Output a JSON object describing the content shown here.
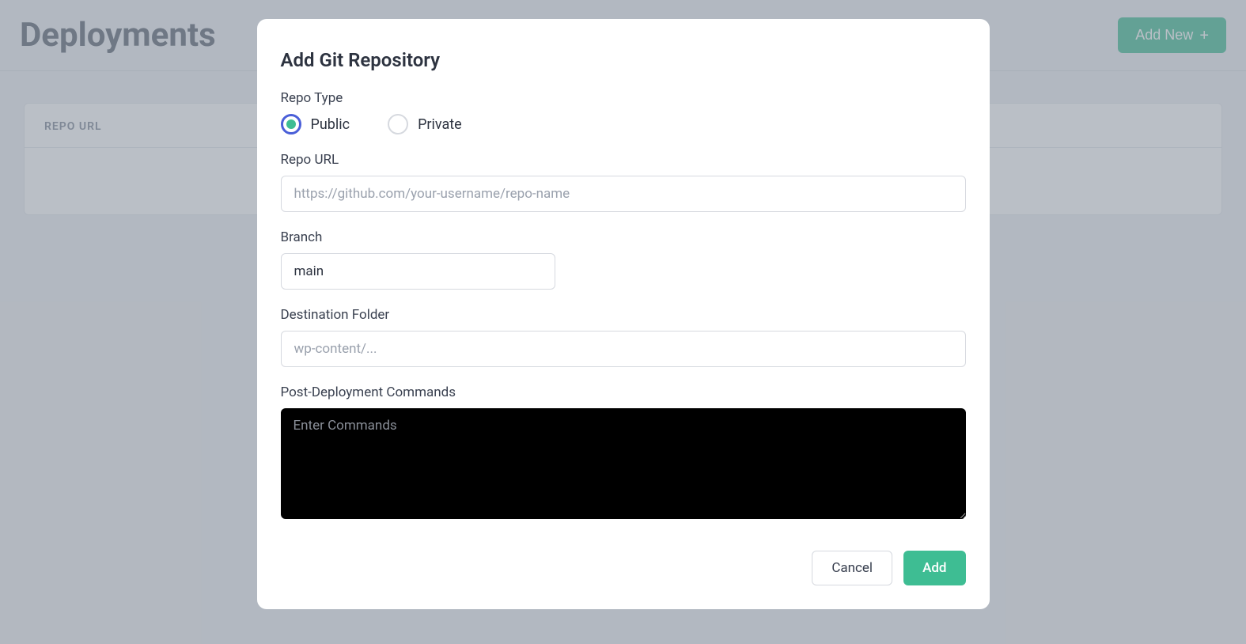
{
  "page": {
    "title": "Deployments",
    "addNewButton": "Add New"
  },
  "table": {
    "columns": [
      "REPO URL"
    ]
  },
  "modal": {
    "title": "Add Git Repository",
    "repoType": {
      "label": "Repo Type",
      "options": {
        "public": "Public",
        "private": "Private"
      },
      "selected": "public"
    },
    "repoUrl": {
      "label": "Repo URL",
      "placeholder": "https://github.com/your-username/repo-name",
      "value": ""
    },
    "branch": {
      "label": "Branch",
      "value": "main"
    },
    "destinationFolder": {
      "label": "Destination Folder",
      "placeholder": "wp-content/...",
      "value": ""
    },
    "postDeployment": {
      "label": "Post-Deployment Commands",
      "placeholder": "Enter Commands",
      "value": ""
    },
    "buttons": {
      "cancel": "Cancel",
      "add": "Add"
    }
  }
}
